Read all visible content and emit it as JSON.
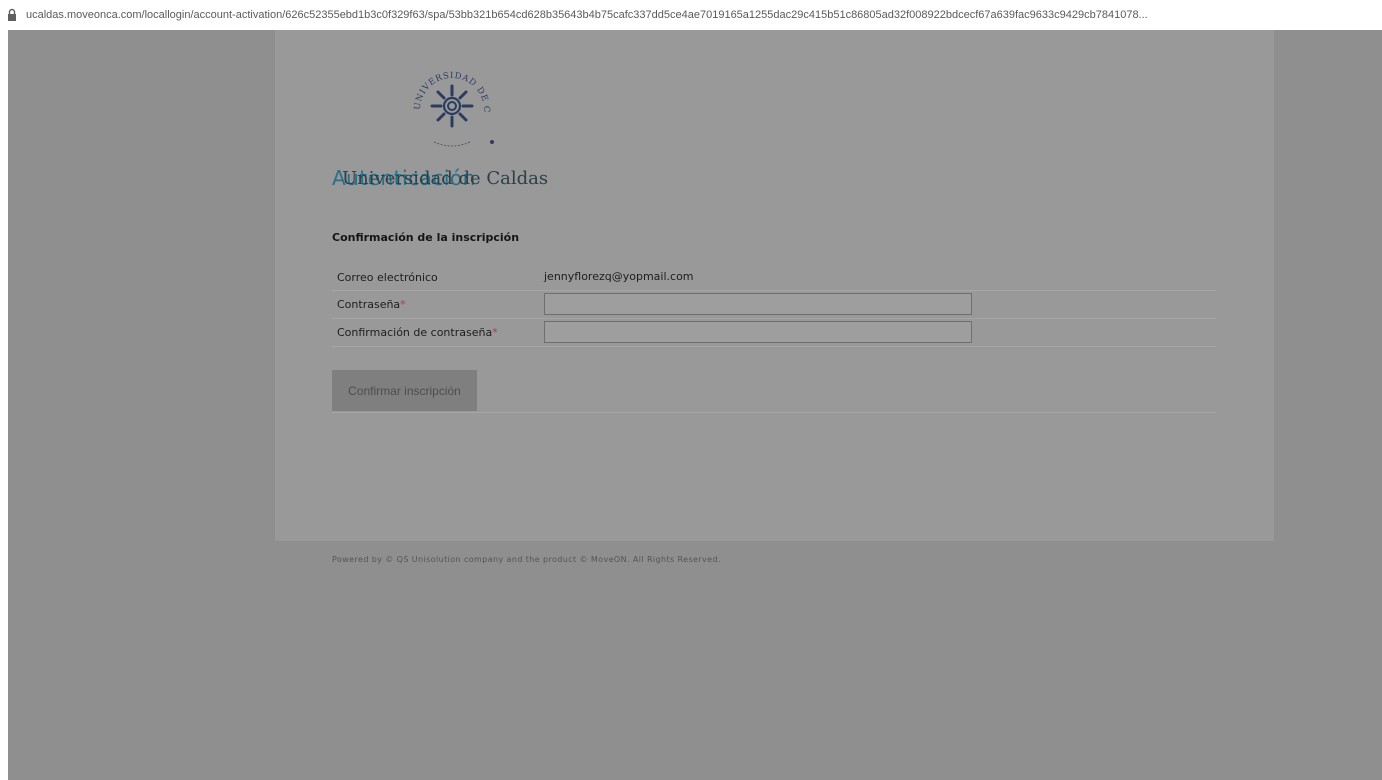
{
  "browser": {
    "url": "ucaldas.moveonca.com/locallogin/account-activation/626c52355ebd1b3c0f329f63/spa/53bb321b654cd628b35643b4b75cafc337dd5ce4ae7019165a1255dac29c415b51c86805ad32f008922bdcecf67a639fac9633c9429cb7841078..."
  },
  "header": {
    "logo_text": "UNIVERSIDAD DE CALDAS",
    "title_overlap_a": "Autenticación",
    "title_overlap_b": "Universidad de Caldas"
  },
  "form": {
    "section_title": "Confirmación de la inscripción",
    "rows": [
      {
        "label": "Correo electrónico",
        "value": "jennyflorezq@yopmail.com",
        "required": false
      },
      {
        "label": "Contraseña",
        "value": "",
        "required": true
      },
      {
        "label": "Confirmación de contraseña",
        "value": "",
        "required": true
      }
    ],
    "required_mark": "*",
    "submit_label": "Confirmar inscripción"
  },
  "footer": {
    "text": "Powered by © QS Unisolution company and the product © MoveON. All Rights Reserved."
  },
  "colors": {
    "backdrop": "#8f8f8f",
    "panel": "#999999",
    "title_accent": "#2b6e85",
    "required": "#b03a3a"
  }
}
